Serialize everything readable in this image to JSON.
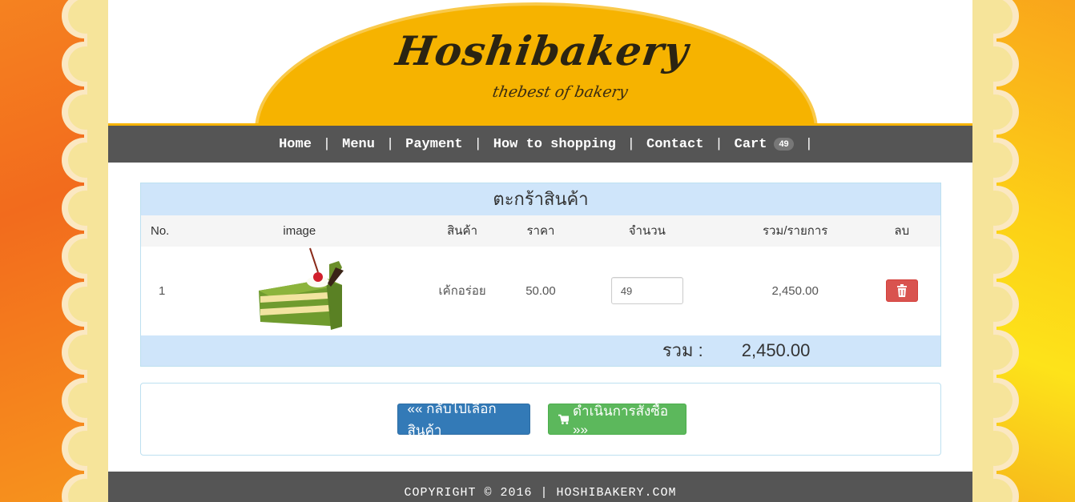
{
  "brand": {
    "name": "Hoshibakery",
    "tagline": "thebest of bakery"
  },
  "nav": {
    "items": [
      {
        "label": "Home"
      },
      {
        "label": "Menu"
      },
      {
        "label": "Payment"
      },
      {
        "label": "How to shopping"
      },
      {
        "label": "Contact"
      },
      {
        "label": "Cart"
      }
    ],
    "cart_count": "49",
    "separator": "|"
  },
  "cart": {
    "title": "ตะกร้าสินค้า",
    "headers": {
      "no": "No.",
      "image": "image",
      "product": "สินค้า",
      "price": "ราคา",
      "quantity": "จำนวน",
      "line_total": "รวม/รายการ",
      "delete": "ลบ"
    },
    "items": [
      {
        "no": "1",
        "image_icon": "green-tea-cake-image",
        "product": "เค้กอร่อย",
        "price": "50.00",
        "quantity": "49",
        "line_total": "2,450.00"
      }
    ],
    "total_label": "รวม :",
    "total_value": "2,450.00"
  },
  "actions": {
    "back_label": "«« กลับไปเลือกสินค้า",
    "checkout_label": "ดำเนินการสั่งซื้อ »»"
  },
  "footer": {
    "copyright": "COPYRIGHT © 2016 | HOSHIBAKERY.COM"
  },
  "colors": {
    "nav_bg": "#555555",
    "header_dome": "#f6b300",
    "table_accent": "#cfe5fa",
    "back_button": "#337ab7",
    "checkout_button": "#5cb85c",
    "delete_button": "#d9534f"
  }
}
